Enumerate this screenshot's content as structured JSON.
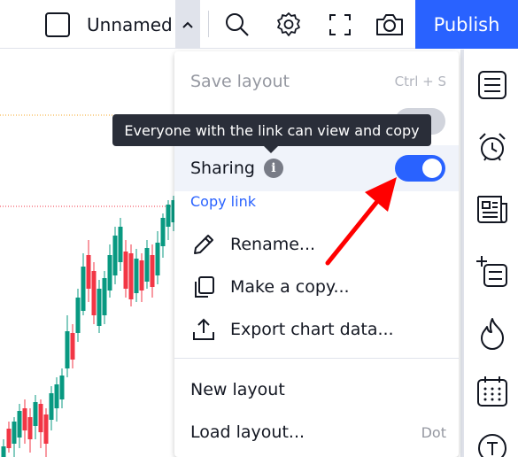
{
  "toolbar": {
    "layout_name": "Unnamed",
    "publish_label": "Publish",
    "icons": [
      "layout-square-icon",
      "chevron-up-icon",
      "search-icon",
      "gear-icon",
      "fullscreen-icon",
      "camera-icon"
    ]
  },
  "tooltip": {
    "text": "Everyone with the link can view and copy"
  },
  "menu": {
    "save_layout": "Save layout",
    "save_shortcut": "Ctrl + S",
    "sharing_label": "Sharing",
    "sharing_enabled": true,
    "copy_link": "Copy link",
    "rename": "Rename...",
    "make_copy": "Make a copy...",
    "export": "Export chart data...",
    "new_layout": "New layout",
    "load_layout": "Load layout...",
    "load_shortcut": "Dot"
  },
  "right_sidebar": {
    "icons": [
      "watchlist-icon",
      "alarm-clock-icon",
      "news-icon",
      "add-list-icon",
      "flame-icon",
      "calendar-icon",
      "text-circle-icon"
    ]
  },
  "colors": {
    "accent": "#2962ff",
    "candle_up": "#089981",
    "candle_down": "#f23645",
    "annotation_arrow": "#ff0000",
    "tooltip_bg": "#2a2e39"
  }
}
